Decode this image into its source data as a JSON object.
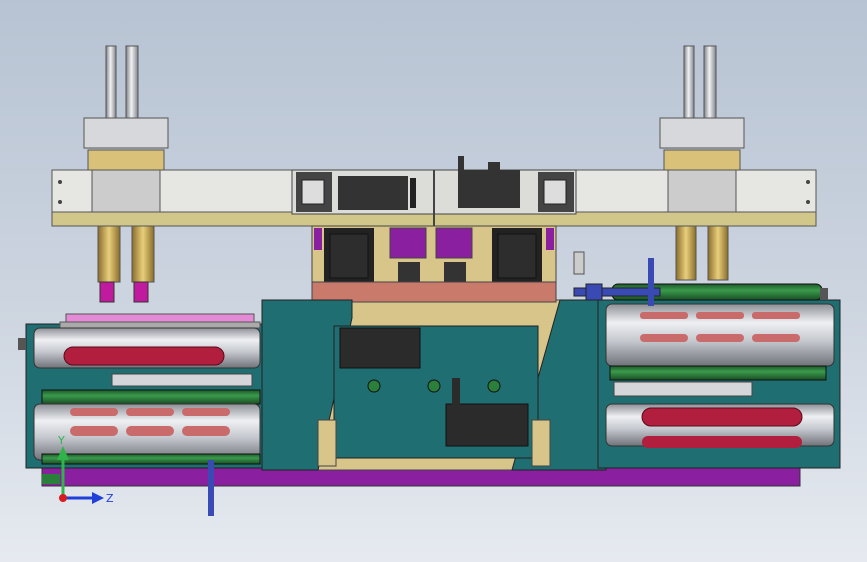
{
  "viewport": {
    "background_top": "#b7c3d3",
    "background_bottom": "#e6eaf0"
  },
  "triad": {
    "y_label": "Y",
    "z_label": "Z",
    "y_color": "#2fb34a",
    "z_color": "#1f3fd8",
    "origin_color": "#d81b1b"
  },
  "colors": {
    "teal": "#1f6f72",
    "tan": "#d9c17a",
    "purple": "#8a1fa0",
    "magenta": "#c01a9e",
    "green_roller": "#2a7f3b",
    "steel": "#c9ccd2",
    "slot": "#b21e3d",
    "rose": "#c96b6b",
    "black": "#2b2b2b"
  }
}
